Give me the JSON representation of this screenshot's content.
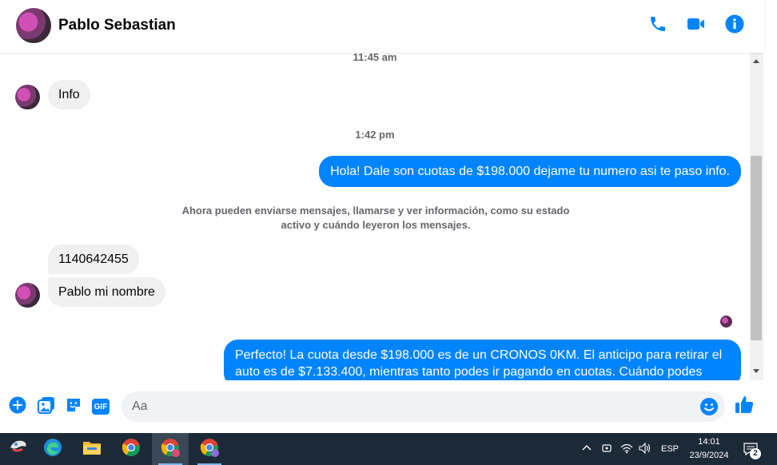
{
  "header": {
    "contact_name": "Pablo Sebastian",
    "actions": [
      {
        "icon": "phone-icon"
      },
      {
        "icon": "video-camera-icon"
      },
      {
        "icon": "info-icon"
      }
    ]
  },
  "messages": {
    "timestamp_1": "11:45 am",
    "incoming_1": "Info",
    "timestamp_2": "1:42 pm",
    "outgoing_1": "Hola! Dale son cuotas de $198.000 dejame tu numero asi te paso info.",
    "system_note": "Ahora pueden enviarse mensajes, llamarse y ver información, como su estado activo y cuándo leyeron los mensajes.",
    "incoming_2": "1140642455",
    "incoming_3": "Pablo mi nombre",
    "outgoing_2": "Perfecto! La cuota desde $198.000 es de un CRONOS 0KM. El anticipo para retirar el auto es de $7.133.400, mientras tanto podes ir pagando en cuotas. Cuándo podes"
  },
  "composer": {
    "placeholder": "Aa",
    "value": "",
    "buttons": [
      "plus-icon",
      "image-icon",
      "sticker-icon",
      "gif-icon",
      "emoji-icon",
      "thumbs-up-icon"
    ],
    "gif_label": "GIF"
  },
  "taskbar": {
    "apps": [
      "start-icon",
      "edge-icon",
      "file-explorer-icon",
      "chrome-icon",
      "chrome-profile-c-icon",
      "chrome-profile-lock-icon"
    ],
    "language": "ESP",
    "time": "14:01",
    "date": "23/9/2024",
    "notification_count": "2"
  },
  "colors": {
    "accent": "#0084ff",
    "incoming_bubble": "#f0f0f0",
    "taskbar": "#1c2a38"
  }
}
